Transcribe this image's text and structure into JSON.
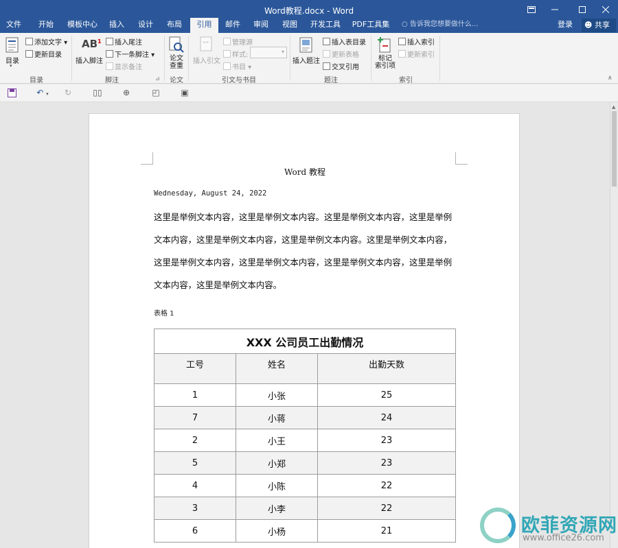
{
  "window": {
    "title": "Word教程.docx - Word"
  },
  "tabs": [
    "文件",
    "开始",
    "模板中心",
    "插入",
    "设计",
    "布局",
    "引用",
    "邮件",
    "审阅",
    "视图",
    "开发工具",
    "PDF工具集"
  ],
  "tell_me": "告诉我您想要做什么...",
  "login": "登录",
  "share": "共享",
  "ribbon": {
    "toc": {
      "big": "目录",
      "add_text": "添加文字",
      "update": "更新目录",
      "group": "目录"
    },
    "footnote": {
      "insert": "插入脚注",
      "endnote": "插入尾注",
      "next": "下一条脚注",
      "show": "显示备注",
      "group": "脚注"
    },
    "paper": {
      "check_l1": "论文",
      "check_l2": "查重",
      "group": "论文"
    },
    "citation": {
      "insert": "插入引文",
      "manage": "管理源",
      "style": "样式:",
      "bib": "书目",
      "group": "引文与书目"
    },
    "caption": {
      "insert": "插入题注",
      "table_of_figures": "插入表目录",
      "update_table": "更新表格",
      "cross_ref": "交叉引用",
      "group": "题注"
    },
    "index": {
      "mark_l1": "标记",
      "mark_l2": "索引项",
      "insert": "插入索引",
      "update": "更新索引",
      "group": "索引"
    }
  },
  "qat": [
    "save-icon",
    "undo-icon",
    "redo-icon",
    "view-icon",
    "link-icon",
    "zoom-icon",
    "clipboard-icon"
  ],
  "document": {
    "title": "Word 教程",
    "date": "Wednesday, August 24, 2022",
    "paragraph_lines": [
      "这里是举例文本内容，这里是举例文本内容。这里是举例文本内容，这里是举例",
      "文本内容，这里是举例文本内容，这里是举例文本内容。这里是举例文本内容，",
      "这里是举例文本内容，这里是举例文本内容，这里是举例文本内容，这里是举例",
      "文本内容，这里是举例文本内容。"
    ],
    "caption": "表格 1",
    "table": {
      "title": "XXX 公司员工出勤情况",
      "headers": [
        "工号",
        "姓名",
        "出勤天数"
      ],
      "rows": [
        [
          "1",
          "小张",
          "25"
        ],
        [
          "7",
          "小蒋",
          "24"
        ],
        [
          "2",
          "小王",
          "23"
        ],
        [
          "5",
          "小郑",
          "23"
        ],
        [
          "4",
          "小陈",
          "22"
        ],
        [
          "3",
          "小李",
          "22"
        ],
        [
          "6",
          "小杨",
          "21"
        ]
      ]
    }
  },
  "watermark": {
    "text": "欧菲资源网",
    "url": "www.office26.com"
  },
  "colors": {
    "accent": "#2b579a",
    "ribbon_bg": "#f3f3f3",
    "workspace": "#e6e6e6"
  }
}
